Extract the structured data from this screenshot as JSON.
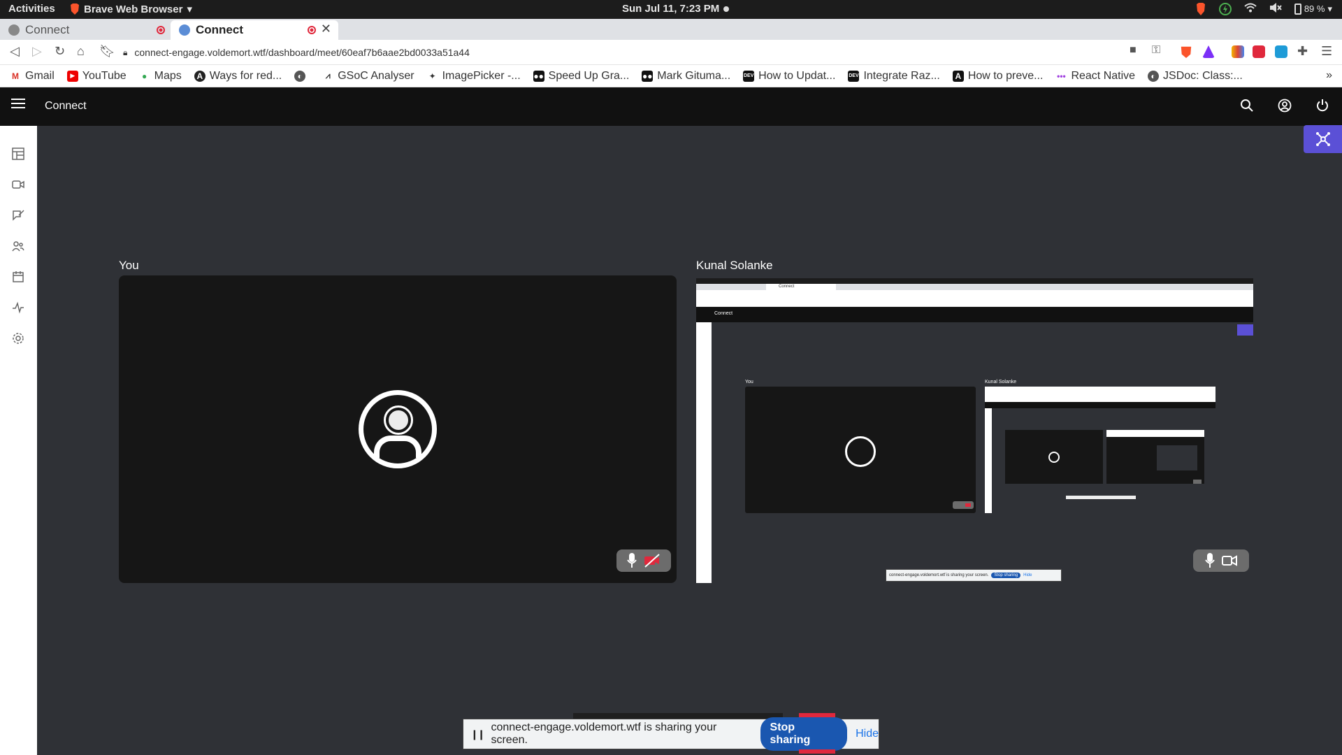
{
  "system_bar": {
    "activities": "Activities",
    "app_name": "Brave Web Browser",
    "clock": "Sun Jul 11,  7:23 PM",
    "battery": "89 %"
  },
  "browser": {
    "tabs": [
      {
        "label": "Connect",
        "active": false
      },
      {
        "label": "Connect",
        "active": true
      }
    ],
    "url": "connect-engage.voldemort.wtf/dashboard/meet/60eaf7b6aae2bd0033a51a44",
    "bookmarks": [
      {
        "label": "Gmail",
        "icon": "gmail-icon"
      },
      {
        "label": "YouTube",
        "icon": "youtube-icon"
      },
      {
        "label": "Maps",
        "icon": "maps-icon"
      },
      {
        "label": "Ways for red...",
        "icon": "site-icon"
      },
      {
        "label": "",
        "icon": "globe-icon"
      },
      {
        "label": "GSoC Analyser",
        "icon": "chart-icon"
      },
      {
        "label": "ImagePicker -...",
        "icon": "site-icon"
      },
      {
        "label": "Speed Up Gra...",
        "icon": "medium-icon"
      },
      {
        "label": "Mark Gituma...",
        "icon": "medium-icon"
      },
      {
        "label": "How to Updat...",
        "icon": "dev-icon"
      },
      {
        "label": "Integrate Raz...",
        "icon": "dev-icon"
      },
      {
        "label": "How to preve...",
        "icon": "site-icon"
      },
      {
        "label": "React Native",
        "icon": "site-icon"
      },
      {
        "label": "JSDoc: Class:...",
        "icon": "globe-icon"
      }
    ],
    "more_bookmarks": "»"
  },
  "app": {
    "title": "Connect"
  },
  "meeting": {
    "self_label": "You",
    "remote_label": "Kunal Solanke"
  },
  "share_bar": {
    "message": "connect-engage.voldemort.wtf is sharing your screen.",
    "stop_label": "Stop sharing",
    "hide_label": "Hide"
  },
  "mini": {
    "title": "Connect",
    "you": "You",
    "remote": "Kunal Solanke",
    "share": "connect-engage.voldemort.wtf is sharing your screen.",
    "stop": "Stop sharing",
    "hide": "Hide"
  },
  "colors": {
    "accent": "#5b50d6",
    "stage_bg": "#2f3136",
    "tile_bg": "#161616",
    "header_bg": "#111111",
    "mute_red": "#e0283c"
  }
}
